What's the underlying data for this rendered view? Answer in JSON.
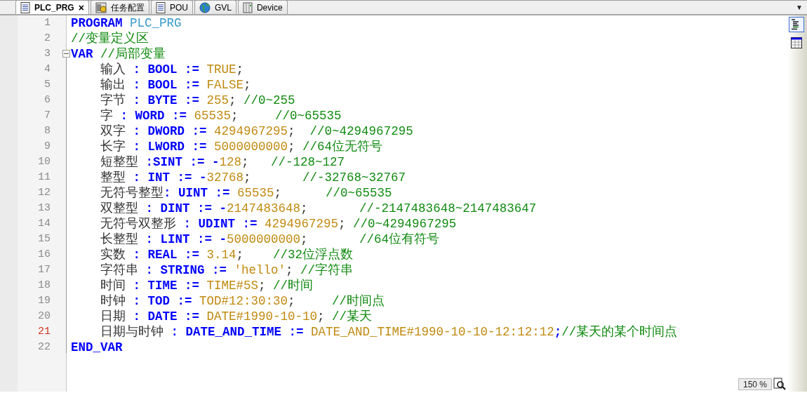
{
  "tabs": [
    {
      "label": "PLC_PRG",
      "kind": "document",
      "selected": true,
      "close": "×"
    },
    {
      "label": "任务配置",
      "kind": "task",
      "selected": false
    },
    {
      "label": "POU",
      "kind": "document",
      "selected": false
    },
    {
      "label": "GVL",
      "kind": "globe",
      "selected": false
    },
    {
      "label": "Device",
      "kind": "device",
      "selected": false
    }
  ],
  "tab_menu": "▼",
  "editor": {
    "lines": [
      {
        "number": "1",
        "current": false,
        "tokens": [
          {
            "kind": "keyword",
            "text": "PROGRAM"
          },
          {
            "kind": "name",
            "text": " PLC_PRG"
          }
        ]
      },
      {
        "number": "2",
        "current": false,
        "tokens": [
          {
            "kind": "comment",
            "text": "//变量定义区"
          }
        ]
      },
      {
        "number": "3",
        "current": false,
        "expanded": true,
        "tokens": [
          {
            "kind": "keyword",
            "text": "VAR"
          },
          {
            "kind": "comment",
            "text": " //局部变量"
          }
        ]
      },
      {
        "number": "4",
        "current": false,
        "tokens": [
          {
            "kind": "text",
            "text": "    输入 "
          },
          {
            "kind": "operator",
            "text": ": "
          },
          {
            "kind": "keyword",
            "text": "BOOL"
          },
          {
            "kind": "operator",
            "text": " := "
          },
          {
            "kind": "value",
            "text": "TRUE"
          },
          {
            "kind": "text",
            "text": ";"
          }
        ]
      },
      {
        "number": "5",
        "current": false,
        "tokens": [
          {
            "kind": "text",
            "text": "    输出 "
          },
          {
            "kind": "operator",
            "text": ": "
          },
          {
            "kind": "keyword",
            "text": "BOOL"
          },
          {
            "kind": "operator",
            "text": " := "
          },
          {
            "kind": "value",
            "text": "FALSE"
          },
          {
            "kind": "text",
            "text": ";"
          }
        ]
      },
      {
        "number": "6",
        "current": false,
        "tokens": [
          {
            "kind": "text",
            "text": "    字节 "
          },
          {
            "kind": "operator",
            "text": ": "
          },
          {
            "kind": "keyword",
            "text": "BYTE"
          },
          {
            "kind": "operator",
            "text": " := "
          },
          {
            "kind": "value",
            "text": "255"
          },
          {
            "kind": "text",
            "text": "; "
          },
          {
            "kind": "comment",
            "text": "//0~255"
          }
        ]
      },
      {
        "number": "7",
        "current": false,
        "tokens": [
          {
            "kind": "text",
            "text": "    字 "
          },
          {
            "kind": "operator",
            "text": ": "
          },
          {
            "kind": "keyword",
            "text": "WORD"
          },
          {
            "kind": "operator",
            "text": " := "
          },
          {
            "kind": "value",
            "text": "65535"
          },
          {
            "kind": "text",
            "text": ";     "
          },
          {
            "kind": "comment",
            "text": "//0~65535"
          }
        ]
      },
      {
        "number": "8",
        "current": false,
        "tokens": [
          {
            "kind": "text",
            "text": "    双字 "
          },
          {
            "kind": "operator",
            "text": ": "
          },
          {
            "kind": "keyword",
            "text": "DWORD"
          },
          {
            "kind": "operator",
            "text": " := "
          },
          {
            "kind": "value",
            "text": "4294967295"
          },
          {
            "kind": "text",
            "text": ";  "
          },
          {
            "kind": "comment",
            "text": "//0~4294967295"
          }
        ]
      },
      {
        "number": "9",
        "current": false,
        "tokens": [
          {
            "kind": "text",
            "text": "    长字 "
          },
          {
            "kind": "operator",
            "text": ": "
          },
          {
            "kind": "keyword",
            "text": "LWORD"
          },
          {
            "kind": "operator",
            "text": " := "
          },
          {
            "kind": "value",
            "text": "5000000000"
          },
          {
            "kind": "text",
            "text": "; "
          },
          {
            "kind": "comment",
            "text": "//64位无符号"
          }
        ]
      },
      {
        "number": "10",
        "current": false,
        "tokens": [
          {
            "kind": "text",
            "text": "    短整型 "
          },
          {
            "kind": "operator",
            "text": ":"
          },
          {
            "kind": "keyword",
            "text": "SINT"
          },
          {
            "kind": "operator",
            "text": " := -"
          },
          {
            "kind": "value",
            "text": "128"
          },
          {
            "kind": "text",
            "text": ";   "
          },
          {
            "kind": "comment",
            "text": "//-128~127"
          }
        ]
      },
      {
        "number": "11",
        "current": false,
        "tokens": [
          {
            "kind": "text",
            "text": "    整型 "
          },
          {
            "kind": "operator",
            "text": ": "
          },
          {
            "kind": "keyword",
            "text": "INT"
          },
          {
            "kind": "operator",
            "text": " := -"
          },
          {
            "kind": "value",
            "text": "32768"
          },
          {
            "kind": "text",
            "text": ";       "
          },
          {
            "kind": "comment",
            "text": "//-32768~32767"
          }
        ]
      },
      {
        "number": "12",
        "current": false,
        "tokens": [
          {
            "kind": "text",
            "text": "    无符号整型"
          },
          {
            "kind": "operator",
            "text": ": "
          },
          {
            "kind": "keyword",
            "text": "UINT"
          },
          {
            "kind": "operator",
            "text": " := "
          },
          {
            "kind": "value",
            "text": "65535"
          },
          {
            "kind": "text",
            "text": ";      "
          },
          {
            "kind": "comment",
            "text": "//0~65535"
          }
        ]
      },
      {
        "number": "13",
        "current": false,
        "tokens": [
          {
            "kind": "text",
            "text": "    双整型 "
          },
          {
            "kind": "operator",
            "text": ": "
          },
          {
            "kind": "keyword",
            "text": "DINT"
          },
          {
            "kind": "operator",
            "text": " := -"
          },
          {
            "kind": "value",
            "text": "2147483648"
          },
          {
            "kind": "text",
            "text": ";       "
          },
          {
            "kind": "comment",
            "text": "//-2147483648~2147483647"
          }
        ]
      },
      {
        "number": "14",
        "current": false,
        "tokens": [
          {
            "kind": "text",
            "text": "    无符号双整形 "
          },
          {
            "kind": "operator",
            "text": ": "
          },
          {
            "kind": "keyword",
            "text": "UDINT"
          },
          {
            "kind": "operator",
            "text": " := "
          },
          {
            "kind": "value",
            "text": "4294967295"
          },
          {
            "kind": "text",
            "text": "; "
          },
          {
            "kind": "comment",
            "text": "//0~4294967295"
          }
        ]
      },
      {
        "number": "15",
        "current": false,
        "tokens": [
          {
            "kind": "text",
            "text": "    长整型 "
          },
          {
            "kind": "operator",
            "text": ": "
          },
          {
            "kind": "keyword",
            "text": "LINT"
          },
          {
            "kind": "operator",
            "text": " := -"
          },
          {
            "kind": "value",
            "text": "5000000000"
          },
          {
            "kind": "text",
            "text": ";       "
          },
          {
            "kind": "comment",
            "text": "//64位有符号"
          }
        ]
      },
      {
        "number": "16",
        "current": false,
        "tokens": [
          {
            "kind": "text",
            "text": "    实数 "
          },
          {
            "kind": "operator",
            "text": ": "
          },
          {
            "kind": "keyword",
            "text": "REAL"
          },
          {
            "kind": "operator",
            "text": " := "
          },
          {
            "kind": "value",
            "text": "3.14"
          },
          {
            "kind": "text",
            "text": ";    "
          },
          {
            "kind": "comment",
            "text": "//32位浮点数"
          }
        ]
      },
      {
        "number": "17",
        "current": false,
        "tokens": [
          {
            "kind": "text",
            "text": "    字符串 "
          },
          {
            "kind": "operator",
            "text": ": "
          },
          {
            "kind": "keyword",
            "text": "STRING"
          },
          {
            "kind": "operator",
            "text": " := "
          },
          {
            "kind": "value",
            "text": "'hello'"
          },
          {
            "kind": "text",
            "text": "; "
          },
          {
            "kind": "comment",
            "text": "//字符串"
          }
        ]
      },
      {
        "number": "18",
        "current": false,
        "tokens": [
          {
            "kind": "text",
            "text": "    时间 "
          },
          {
            "kind": "operator",
            "text": ": "
          },
          {
            "kind": "keyword",
            "text": "TIME"
          },
          {
            "kind": "operator",
            "text": " := "
          },
          {
            "kind": "value",
            "text": "TIME#5S"
          },
          {
            "kind": "text",
            "text": "; "
          },
          {
            "kind": "comment",
            "text": "//时间"
          }
        ]
      },
      {
        "number": "19",
        "current": false,
        "tokens": [
          {
            "kind": "text",
            "text": "    时钟 "
          },
          {
            "kind": "operator",
            "text": ": "
          },
          {
            "kind": "keyword",
            "text": "TOD"
          },
          {
            "kind": "operator",
            "text": " := "
          },
          {
            "kind": "value",
            "text": "TOD#12:30:30"
          },
          {
            "kind": "text",
            "text": ";     "
          },
          {
            "kind": "comment",
            "text": "//时间点"
          }
        ]
      },
      {
        "number": "20",
        "current": false,
        "tokens": [
          {
            "kind": "text",
            "text": "    日期 "
          },
          {
            "kind": "operator",
            "text": ": "
          },
          {
            "kind": "keyword",
            "text": "DATE"
          },
          {
            "kind": "operator",
            "text": " := "
          },
          {
            "kind": "value",
            "text": "DATE#1990-10-10"
          },
          {
            "kind": "text",
            "text": "; "
          },
          {
            "kind": "comment",
            "text": "//某天"
          }
        ]
      },
      {
        "number": "21",
        "current": true,
        "tokens": [
          {
            "kind": "text",
            "text": "    日期与时钟 "
          },
          {
            "kind": "operator",
            "text": ": "
          },
          {
            "kind": "keyword",
            "text": "DATE_AND_TIME"
          },
          {
            "kind": "operator",
            "text": " := "
          },
          {
            "kind": "value",
            "text": "DATE_AND_TIME#1990-10-10-12:12:12"
          },
          {
            "kind": "operator",
            "text": ";"
          },
          {
            "kind": "comment",
            "text": "//某天的某个时间点"
          }
        ]
      },
      {
        "number": "22",
        "current": false,
        "tokens": [
          {
            "kind": "keyword",
            "text": "END_VAR"
          }
        ]
      }
    ]
  },
  "view_buttons": [
    {
      "kind": "text",
      "selected": true
    },
    {
      "kind": "table",
      "selected": false
    }
  ],
  "zoom": {
    "value": "150 %"
  }
}
